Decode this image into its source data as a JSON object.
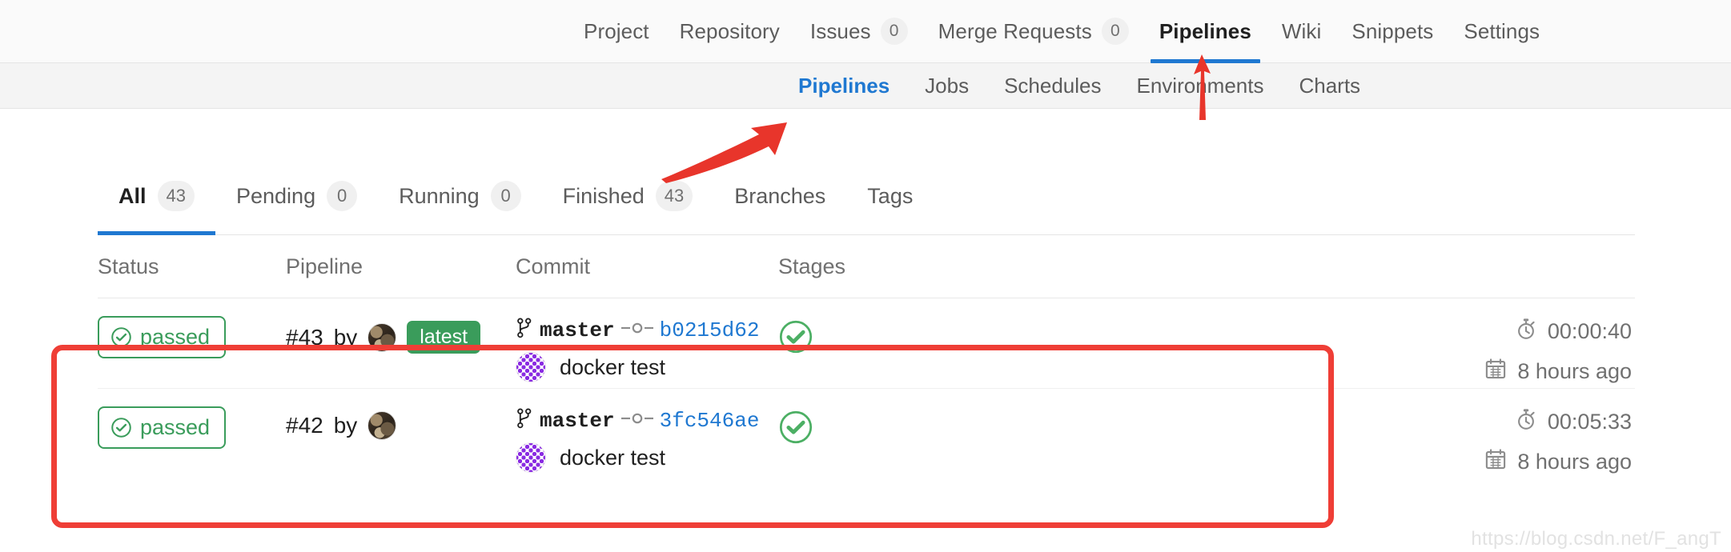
{
  "top_nav": {
    "items": [
      {
        "label": "Project",
        "count": null,
        "active": false
      },
      {
        "label": "Repository",
        "count": null,
        "active": false
      },
      {
        "label": "Issues",
        "count": "0",
        "active": false
      },
      {
        "label": "Merge Requests",
        "count": "0",
        "active": false
      },
      {
        "label": "Pipelines",
        "count": null,
        "active": true
      },
      {
        "label": "Wiki",
        "count": null,
        "active": false
      },
      {
        "label": "Snippets",
        "count": null,
        "active": false
      },
      {
        "label": "Settings",
        "count": null,
        "active": false
      }
    ]
  },
  "sub_nav": {
    "items": [
      {
        "label": "Pipelines",
        "active": true
      },
      {
        "label": "Jobs",
        "active": false
      },
      {
        "label": "Schedules",
        "active": false
      },
      {
        "label": "Environments",
        "active": false
      },
      {
        "label": "Charts",
        "active": false
      }
    ]
  },
  "filter_tabs": {
    "items": [
      {
        "label": "All",
        "count": "43",
        "active": true
      },
      {
        "label": "Pending",
        "count": "0",
        "active": false
      },
      {
        "label": "Running",
        "count": "0",
        "active": false
      },
      {
        "label": "Finished",
        "count": "43",
        "active": false
      },
      {
        "label": "Branches",
        "count": null,
        "active": false
      },
      {
        "label": "Tags",
        "count": null,
        "active": false
      }
    ]
  },
  "table": {
    "headers": {
      "status": "Status",
      "pipeline": "Pipeline",
      "commit": "Commit",
      "stages": "Stages"
    },
    "rows": [
      {
        "status": "passed",
        "pipeline_id": "#43",
        "pipeline_by": "by",
        "latest_label": "latest",
        "branch": "master",
        "sha": "b0215d62",
        "commit_title": "docker test",
        "stage_status": "passed",
        "duration": "00:00:40",
        "timestamp": "8 hours ago"
      },
      {
        "status": "passed",
        "pipeline_id": "#42",
        "pipeline_by": "by",
        "latest_label": null,
        "branch": "master",
        "sha": "3fc546ae",
        "commit_title": "docker test",
        "stage_status": "passed",
        "duration": "00:05:33",
        "timestamp": "8 hours ago"
      }
    ]
  },
  "annotations": {
    "highlight_color": "#ef3e36",
    "arrow_color": "#e8352b"
  },
  "watermark": "https://blog.csdn.net/F_angT",
  "colors": {
    "accent_blue": "#1f78d1",
    "success_green": "#3a9c5b",
    "link_blue": "#1f78d1",
    "identicon_purple": "#8a2be2"
  }
}
